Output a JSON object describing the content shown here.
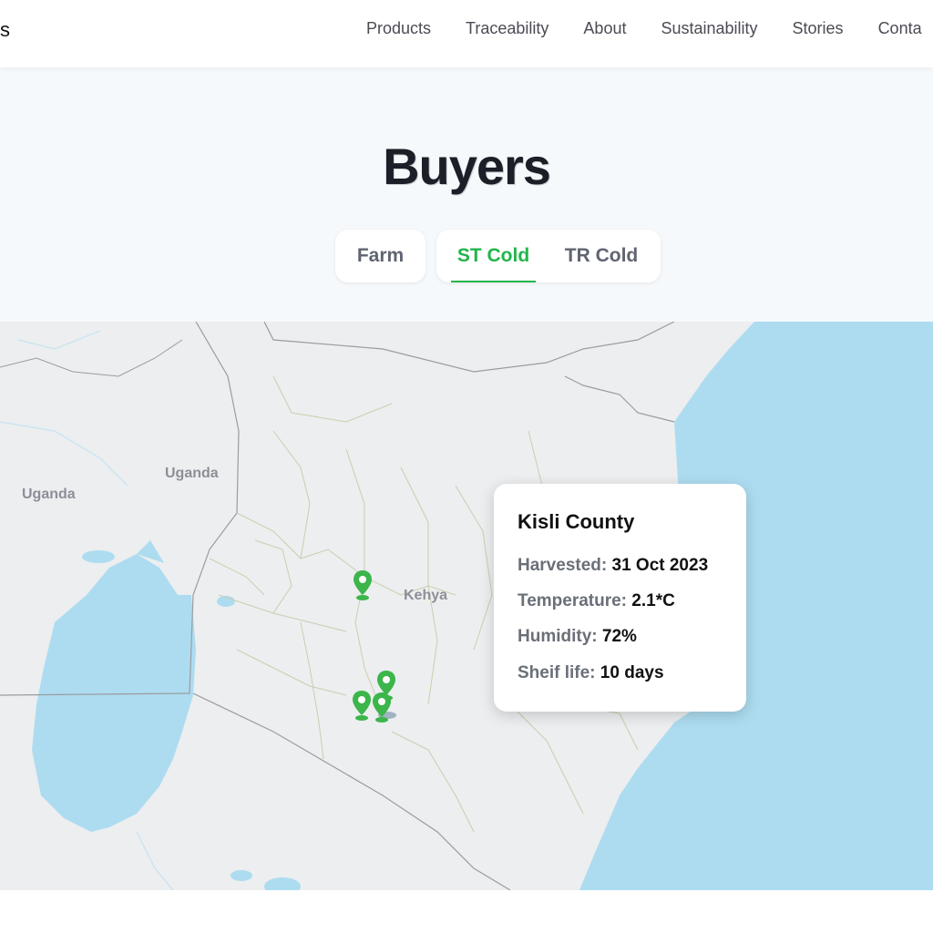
{
  "header": {
    "brand_fragment": "s",
    "nav": [
      "Products",
      "Traceability",
      "About",
      "Sustainability",
      "Stories",
      "Conta"
    ]
  },
  "hero": {
    "title": "Buyers",
    "tabs": [
      {
        "label": "Farm",
        "active": false
      },
      {
        "label": "ST Cold",
        "active": true
      },
      {
        "label": "TR Cold",
        "active": false
      }
    ],
    "accent_color": "#22b54b"
  },
  "map": {
    "labels": [
      "Uganda",
      "Uganda",
      "Kehya"
    ],
    "water_color": "#addcf0",
    "land_color": "#eceef0",
    "pin_color": "#3cb54a",
    "pins": [
      "map-pin",
      "map-pin",
      "map-pin",
      "map-pin"
    ]
  },
  "popup": {
    "title": "Kisli County",
    "rows": [
      {
        "label": "Harvested:",
        "value": "31 Oct 2023"
      },
      {
        "label": "Temperature:",
        "value": "2.1*C"
      },
      {
        "label": "Humidity:",
        "value": "72%"
      },
      {
        "label": "Sheif life:",
        "value": "10 days"
      }
    ]
  }
}
